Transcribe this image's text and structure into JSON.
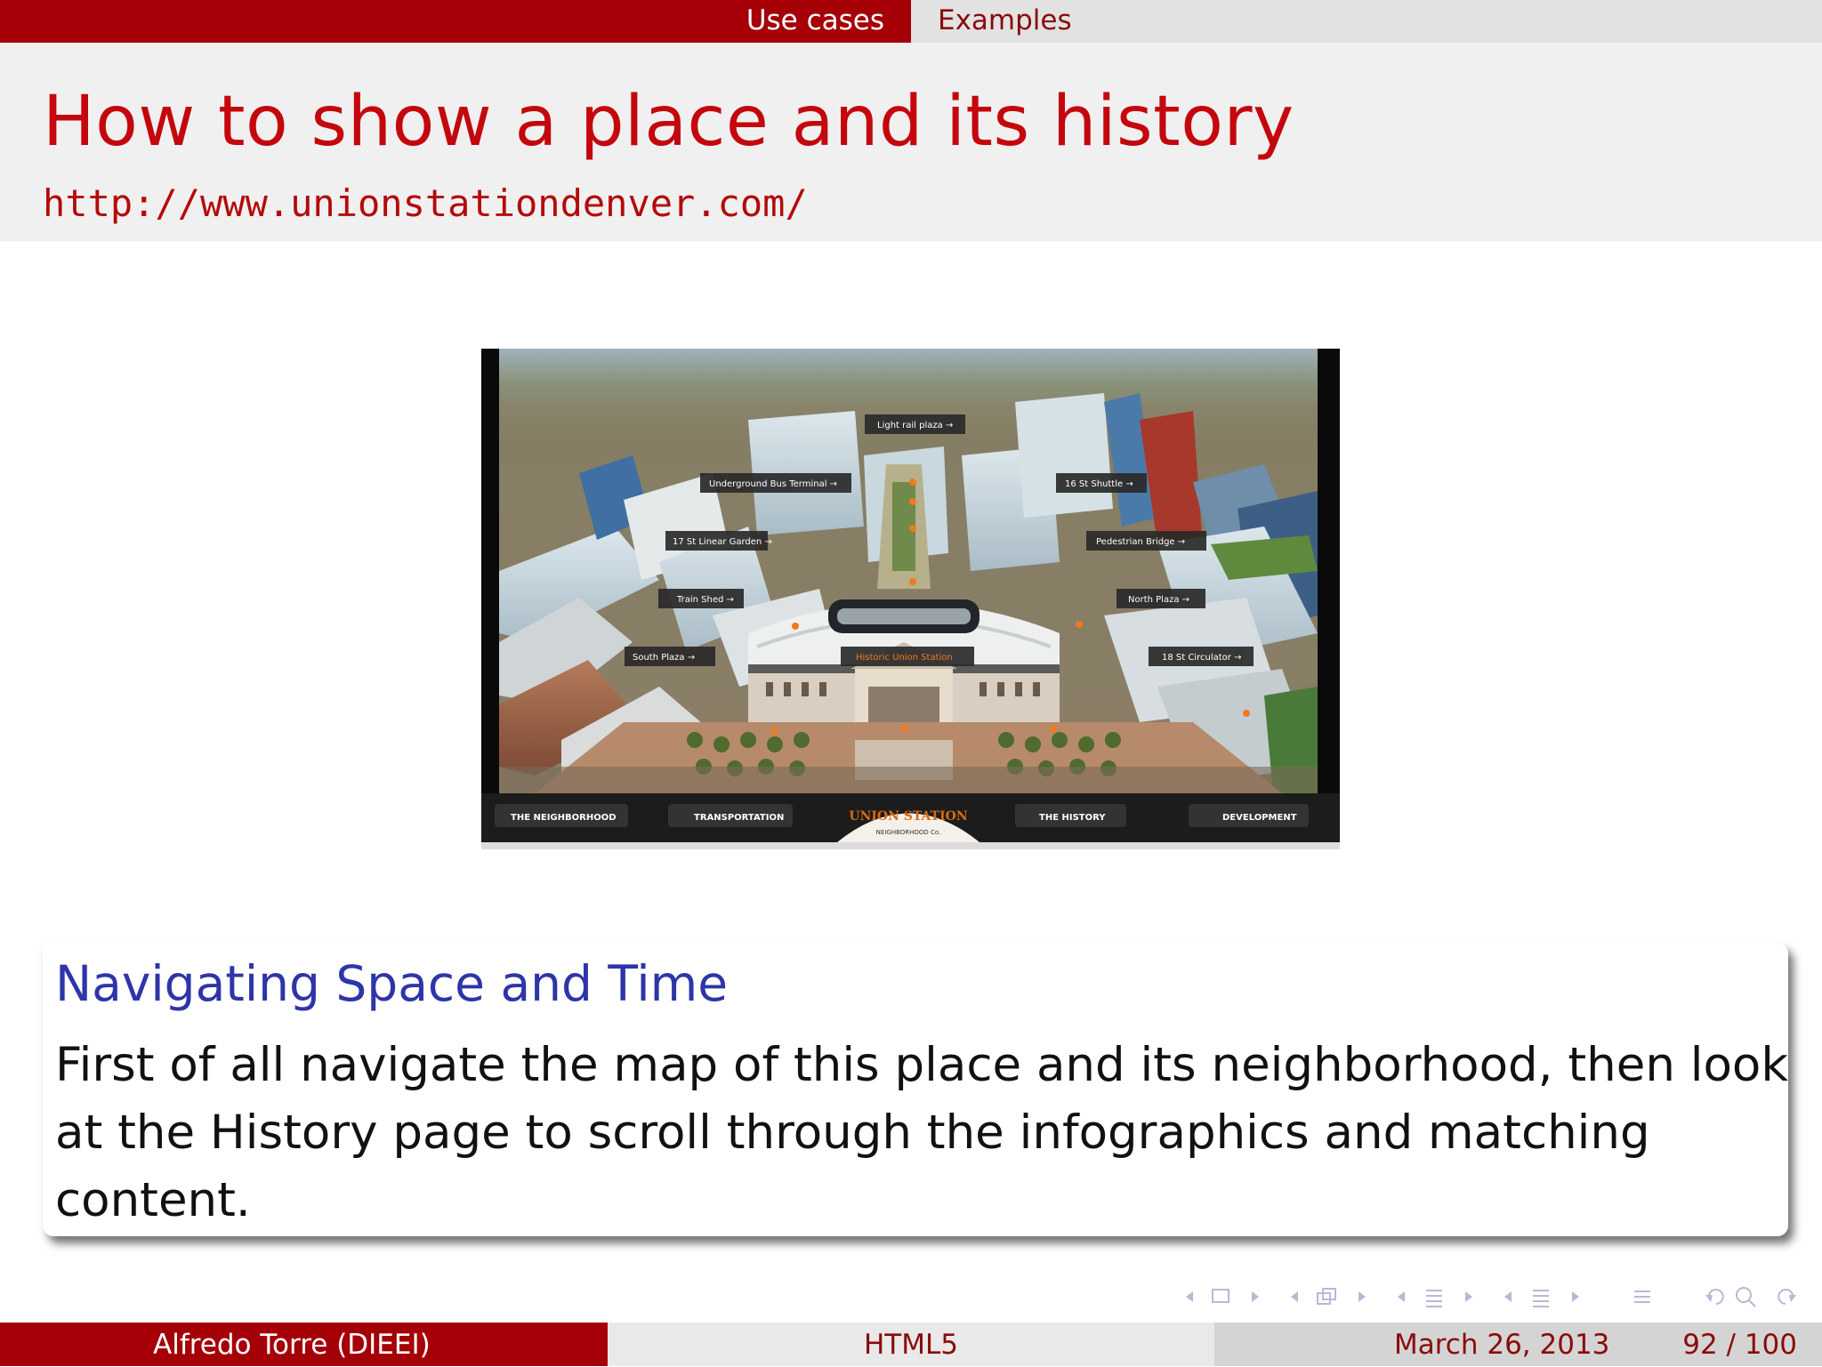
{
  "header": {
    "sections": [
      {
        "label": "Use cases",
        "active": true
      },
      {
        "label": "Examples",
        "active": false
      }
    ]
  },
  "slide": {
    "title": "How to show a place and its history",
    "url": "http://www.unionstationdenver.com/"
  },
  "screenshot": {
    "map_labels": [
      "Light rail plaza →",
      "Underground Bus Terminal →",
      "16 St Shuttle →",
      "17 St Linear Garden →",
      "Pedestrian Bridge →",
      "Train Shed →",
      "North Plaza →",
      "South Plaza →",
      "Historic Union Station",
      "18 St Circulator →"
    ],
    "nav_items": [
      "THE NEIGHBORHOOD",
      "TRANSPORTATION",
      "THE HISTORY",
      "DEVELOPMENT"
    ],
    "logo_text": "UNION STATION",
    "logo_subtext": "NEIGHBORHOOD Co."
  },
  "block": {
    "title": "Navigating Space and Time",
    "body": "First of all navigate the map of this place and its neighborhood, then look at the History page to scroll through the infographics and matching content."
  },
  "footer": {
    "author": "Alfredo Torre  (DIEEI)",
    "title": "HTML5",
    "date": "March 26, 2013",
    "page": "92 / 100"
  },
  "colors": {
    "accent_red": "#a50008",
    "title_red": "#c4060d",
    "block_title_blue": "#2e35a8",
    "map_marker_orange": "#f07a1e"
  },
  "nav_icons": [
    "nav-prev-icon",
    "frame-icon",
    "nav-next-icon",
    "subsection-icon",
    "section-icon",
    "align-icon",
    "search-icon",
    "loop-icon"
  ]
}
